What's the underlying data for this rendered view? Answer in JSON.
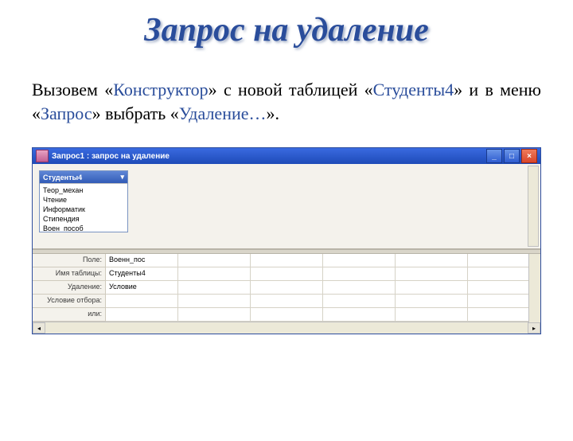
{
  "title": "Запрос на удаление",
  "description": {
    "pre1": "Вызовем «",
    "kw1": "Конструктор",
    "mid1": "» с новой таблицей «",
    "kw2": "Студенты4",
    "mid2": "» и в меню «",
    "kw3": "Запрос",
    "mid3": "» выбрать «",
    "kw4": "Удаление…",
    "post": "»."
  },
  "window": {
    "title": "Запрос1 : запрос на удаление",
    "table_box_title": "Студенты4",
    "table_fields": [
      "Теор_механ",
      "Чтение",
      "Информатик",
      "Стипендия",
      "Воен_пособ"
    ],
    "row_labels": [
      "Поле:",
      "Имя таблицы:",
      "Удаление:",
      "Условие отбора:",
      "или:"
    ],
    "col1": [
      "Военн_пос",
      "Студенты4",
      "Условие",
      "",
      ""
    ]
  }
}
